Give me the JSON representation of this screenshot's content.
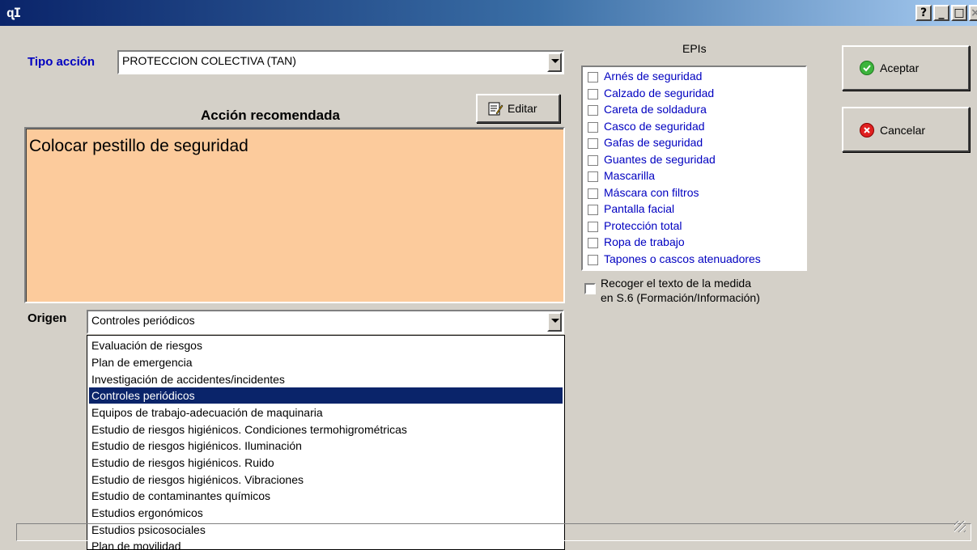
{
  "title_bar": {
    "icon": "app-logo-icon",
    "icon_glyph": "ɋI",
    "help_glyph": "?",
    "minimize_glyph": "_",
    "maximize_glyph": "□",
    "close_glyph": "×"
  },
  "tipo_accion": {
    "label": "Tipo acción",
    "value": "PROTECCION COLECTIVA (TAN)"
  },
  "accion": {
    "heading": "Acción recomendada",
    "edit_button": "Editar",
    "text": "Colocar pestillo de seguridad",
    "memo_color": "#fccb9c"
  },
  "origen": {
    "label": "Origen",
    "value": "Controles periódicos",
    "options": [
      "Evaluación de riesgos",
      "Plan de emergencia",
      "Investigación de accidentes/incidentes",
      "Controles periódicos",
      "Equipos de trabajo-adecuación de maquinaria",
      "Estudio de riesgos higiénicos. Condiciones termohigrométricas",
      "Estudio de riesgos higiénicos. Iluminación",
      "Estudio de riesgos higiénicos. Ruido",
      "Estudio de riesgos higiénicos. Vibraciones",
      "Estudio de contaminantes químicos",
      "Estudios ergonómicos",
      "Estudios psicosociales",
      "Plan de movilidad"
    ],
    "selected_index": 3,
    "selected_color": "#0a246a"
  },
  "epis": {
    "title": "EPIs",
    "items": [
      "Arnés de seguridad",
      "Calzado de seguridad",
      "Careta de soldadura",
      "Casco de seguridad",
      "Gafas de seguridad",
      "Guantes de seguridad",
      "Mascarilla",
      "Máscara con filtros",
      "Pantalla facial",
      "Protección total",
      "Ropa de trabajo",
      "Tapones o cascos atenuadores"
    ],
    "text_color": "#0000c0"
  },
  "recoger": {
    "line1": "Recoger el texto de la medida",
    "line2": "en S.6 (Formación/Información)"
  },
  "buttons": {
    "accept": "Aceptar",
    "accept_icon": "check-circle-icon",
    "accept_color": "#3cb43c",
    "cancel": "Cancelar",
    "cancel_icon": "x-circle-icon",
    "cancel_color": "#e02020"
  }
}
